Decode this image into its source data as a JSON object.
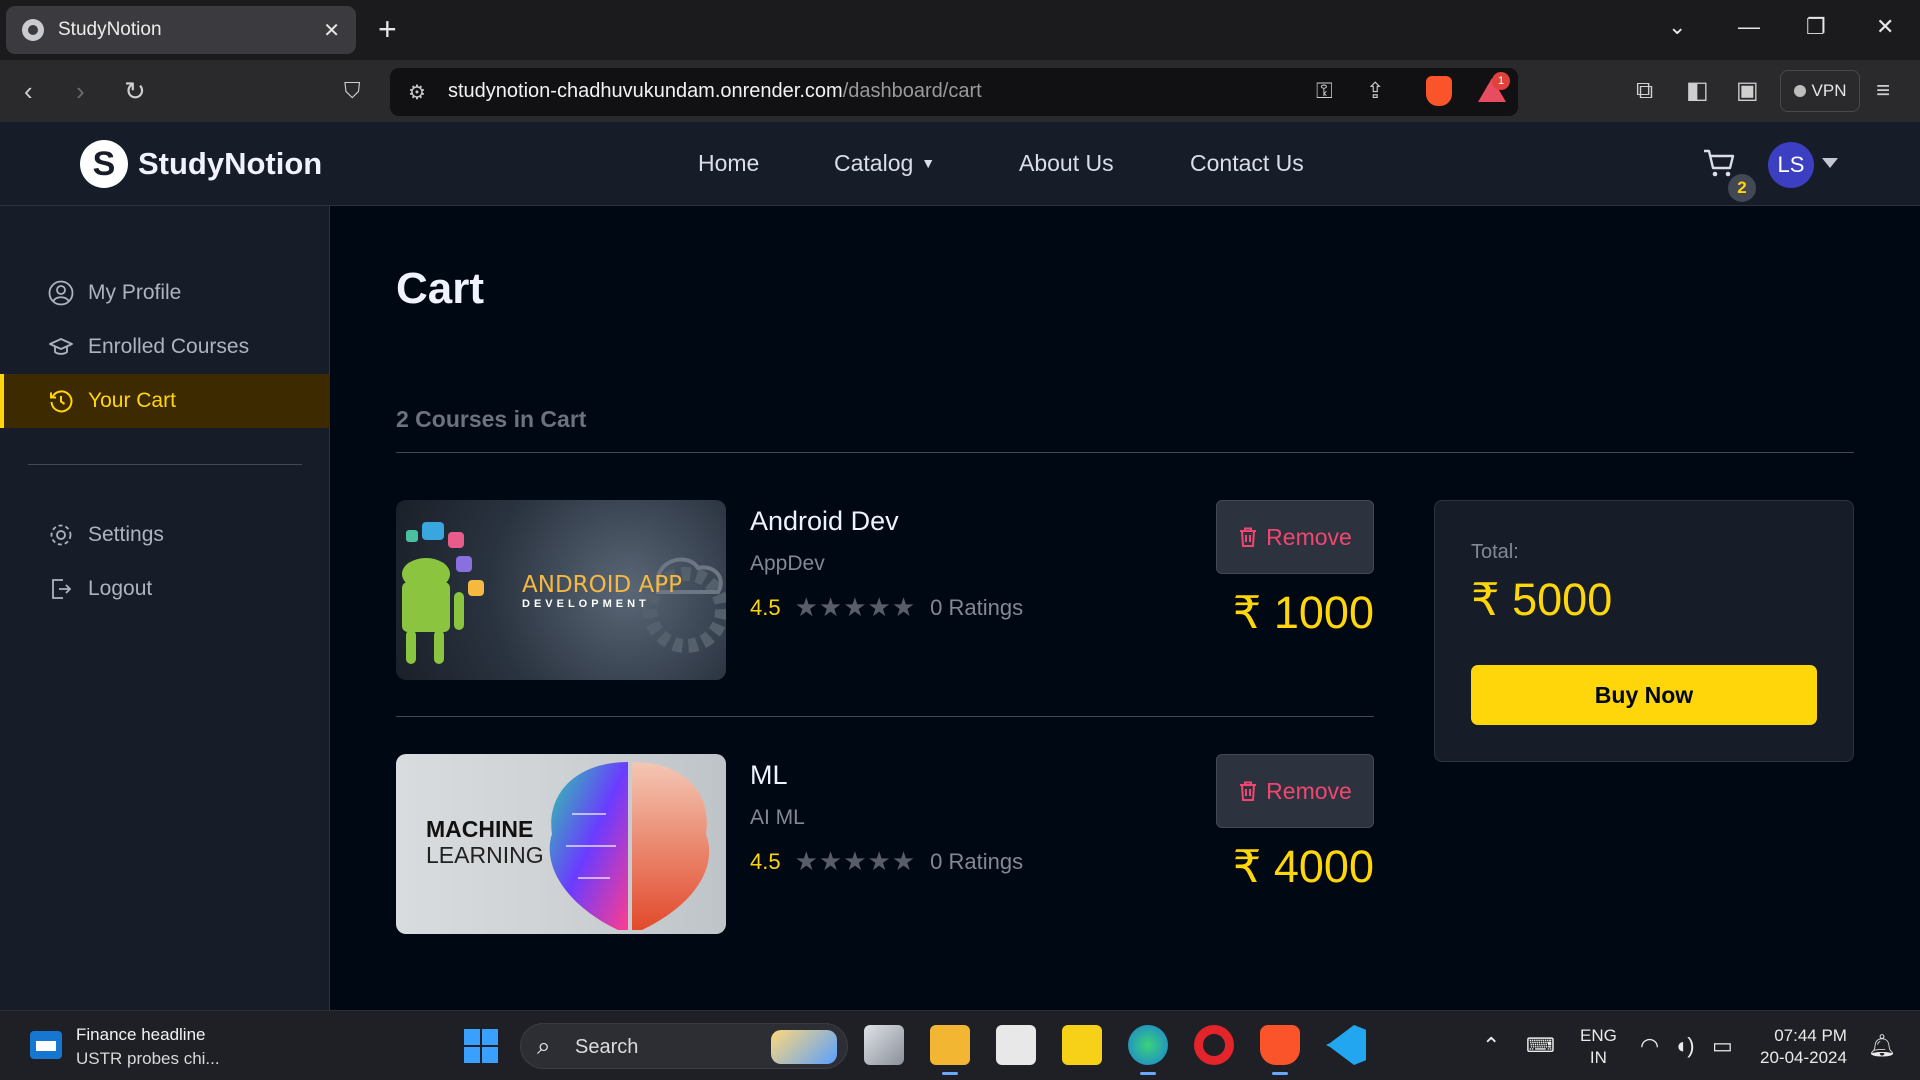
{
  "browser": {
    "tab_title": "StudyNotion",
    "url_host": "studynotion-chadhuvukundam.onrender.com",
    "url_path": "/dashboard/cart",
    "vpn_label": "VPN",
    "brave_alert_count": "1"
  },
  "site": {
    "logo_letter": "S",
    "logo_text": "StudyNotion",
    "nav": [
      "Home",
      "Catalog",
      "About Us",
      "Contact Us"
    ],
    "cart_count": "2",
    "avatar_initials": "LS"
  },
  "sidebar": {
    "items": [
      {
        "label": "My Profile",
        "icon": "user-circle-icon"
      },
      {
        "label": "Enrolled Courses",
        "icon": "graduation-cap-icon"
      },
      {
        "label": "Your Cart",
        "icon": "history-icon",
        "active": true
      },
      {
        "label": "Settings",
        "icon": "gear-icon"
      },
      {
        "label": "Logout",
        "icon": "logout-icon"
      }
    ]
  },
  "main": {
    "title": "Cart",
    "count_label": "2 Courses in Cart",
    "courses": [
      {
        "title": "Android Dev",
        "category": "AppDev",
        "rating": "4.5",
        "stars": "★★★★★",
        "ratings_count": "0 Ratings",
        "remove_label": "Remove",
        "price": "₹ 1000",
        "thumb_text_1": "ANDROID APP",
        "thumb_text_2": "DEVELOPMENT"
      },
      {
        "title": "ML",
        "category": "AI ML",
        "rating": "4.5",
        "stars": "★★★★★",
        "ratings_count": "0 Ratings",
        "remove_label": "Remove",
        "price": "₹ 4000",
        "thumb_text_1": "MACHINE",
        "thumb_text_2": "LEARNING"
      }
    ],
    "summary": {
      "total_label": "Total:",
      "total_amount": "₹ 5000",
      "buy_label": "Buy Now"
    }
  },
  "taskbar": {
    "news_title": "Finance headline",
    "news_sub": "USTR probes chi...",
    "search_label": "Search",
    "lang_1": "ENG",
    "lang_2": "IN",
    "time": "07:44 PM",
    "date": "20-04-2024"
  },
  "colors": {
    "accent_yellow": "#FFD60A",
    "remove_pink": "#EF476F",
    "bg": "#000814",
    "panel": "#161D29"
  }
}
